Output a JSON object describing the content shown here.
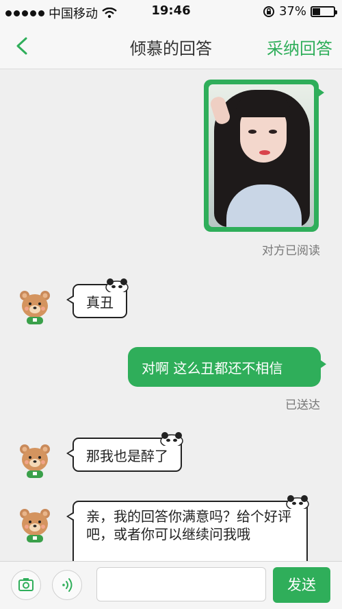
{
  "status_bar": {
    "carrier": "中国移动",
    "time": "19:46",
    "battery": "37%",
    "battery_level": 0.37,
    "signal_icon": "signal-dots-icon",
    "wifi_icon": "wifi-icon",
    "lock_icon": "rotation-lock-icon"
  },
  "nav": {
    "back_icon": "chevron-left-icon",
    "title": "倾慕的回答",
    "action": "采纳回答"
  },
  "messages": [
    {
      "side": "right",
      "type": "image",
      "status": "对方已阅读"
    },
    {
      "side": "left",
      "text": "真丑"
    },
    {
      "side": "right",
      "text": "对啊 这么丑都还不相信",
      "status": "已送达"
    },
    {
      "side": "left",
      "text": "那我也是醉了"
    },
    {
      "side": "left",
      "text": "亲，我的回答你满意吗？给个好评吧，或者你可以继续问我哦"
    }
  ],
  "input_bar": {
    "camera_icon": "camera-icon",
    "voice_icon": "voice-icon",
    "placeholder": "",
    "send_label": "发送"
  },
  "colors": {
    "accent": "#2fae5a",
    "background": "#efefef"
  }
}
